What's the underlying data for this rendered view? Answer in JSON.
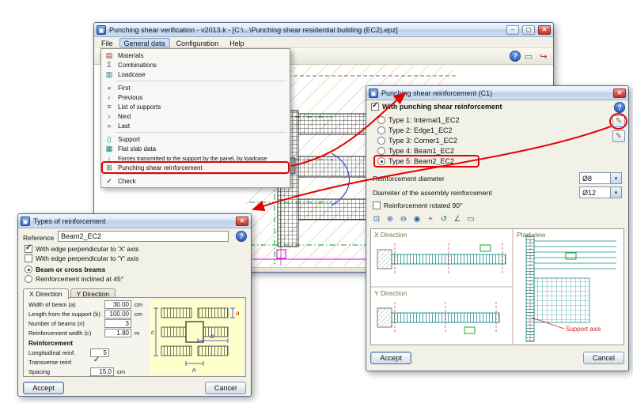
{
  "icons": {
    "app": "▣",
    "close": "✕",
    "minimize": "–",
    "maximize": "▢",
    "help": "?",
    "edit": "✎",
    "check_green": "✓",
    "dropdown": "▾",
    "menu": {
      "materials": "▤",
      "combinations": "Σ",
      "loadcase": "▥",
      "first": "«",
      "previous": "‹",
      "list_of_supports": "≡",
      "next": "›",
      "last": "»",
      "support": "▯",
      "flat_slab_data": "▦",
      "forces": "↓",
      "punching_shear": "⊞",
      "check": "✓"
    },
    "toolbar": {
      "open": "▤",
      "print": "▭",
      "zoom_window": "⊡",
      "zoom_in": "⊕",
      "zoom_out": "⊖",
      "zoom_all": "◉",
      "pan": "+",
      "grid": "⊞",
      "layers": "▦",
      "redraw": "↺",
      "measure": "∠",
      "exit": "↪"
    }
  },
  "win_main": {
    "title": "Punching shear verification - v2013.k - [C:\\...\\Punching shear residential building (EC2).epz]",
    "menubar": [
      {
        "label": "File",
        "active": false
      },
      {
        "label": "General data",
        "active": true
      },
      {
        "label": "Configuration",
        "active": false
      },
      {
        "label": "Help",
        "active": false
      }
    ],
    "menu_items": [
      {
        "label": "Materials"
      },
      {
        "label": "Combinations"
      },
      {
        "label": "Loadcase"
      },
      {
        "label": "First"
      },
      {
        "label": "Previous"
      },
      {
        "label": "List of supports"
      },
      {
        "label": "Next"
      },
      {
        "label": "Last"
      },
      {
        "label": "Support"
      },
      {
        "label": "Flat slab data"
      },
      {
        "label": "Forces transmitted to the support by the panel, by loadcase"
      },
      {
        "label": "Punching shear reinforcement",
        "highlighted": true
      },
      {
        "label": "Check"
      }
    ]
  },
  "win_reinf": {
    "title": "Punching shear reinforcement (C1)",
    "with_label": "With punching shear reinforcement",
    "with_checked": true,
    "types": [
      {
        "label": "Type 1: Internal1_EC2",
        "selected": false
      },
      {
        "label": "Type 2: Edge1_EC2",
        "selected": false
      },
      {
        "label": "Type 3: Corner1_EC2",
        "selected": false
      },
      {
        "label": "Type 4: Beam1_EC2",
        "selected": false
      },
      {
        "label": "Type 5: Beam2_EC2",
        "selected": true
      }
    ],
    "diameter_label": "Reinforcement diameter",
    "diameter_value": "Ø8",
    "assembly_label": "Diameter of the assembly reinforcement",
    "assembly_value": "Ø12",
    "rotated_label": "Reinforcement rotated 90°",
    "rotated_checked": false,
    "preview": {
      "x_direction": "X Direction",
      "y_direction": "Y Direction",
      "plan_view": "Plan view",
      "support_axis": "Support axis"
    },
    "accept": "Accept",
    "cancel": "Cancel"
  },
  "win_types": {
    "title": "Types of reinforcement",
    "reference_label": "Reference",
    "reference_value": "Beam2_EC2",
    "edge_x_label": "With edge perpendicular to 'X' axis",
    "edge_x_checked": true,
    "edge_y_label": "With edge perpendicular to 'Y' axis",
    "edge_y_checked": false,
    "beams_label": "Beam or cross beams",
    "beams_selected": true,
    "inclined_label": "Reinforcement inclined at 45°",
    "inclined_selected": false,
    "tabs": [
      {
        "label": "X Direction",
        "active": true
      },
      {
        "label": "Y Direction",
        "active": false
      }
    ],
    "fields": [
      {
        "label": "Width of beam (a)",
        "value": "30.00",
        "unit": "cm"
      },
      {
        "label": "Length from the support (b)",
        "value": "100.00",
        "unit": "cm"
      },
      {
        "label": "Number of beams (n)",
        "value": "3",
        "unit": ""
      },
      {
        "label": "Reinforcement width (c)",
        "value": "1.80",
        "unit": "m"
      }
    ],
    "reinforcement_label": "Reinforcement",
    "longitudinal_label": "Longitudinal reinf.",
    "longitudinal_value": "5",
    "transverse_label": "Transverse reinf.",
    "transverse_checked": true,
    "spacing_label": "Spacing",
    "spacing_value": "15.0",
    "spacing_unit": "cm",
    "dim_labels": {
      "a": "a",
      "b": "b",
      "c": "c",
      "n": "n"
    },
    "accept": "Accept",
    "cancel": "Cancel"
  }
}
